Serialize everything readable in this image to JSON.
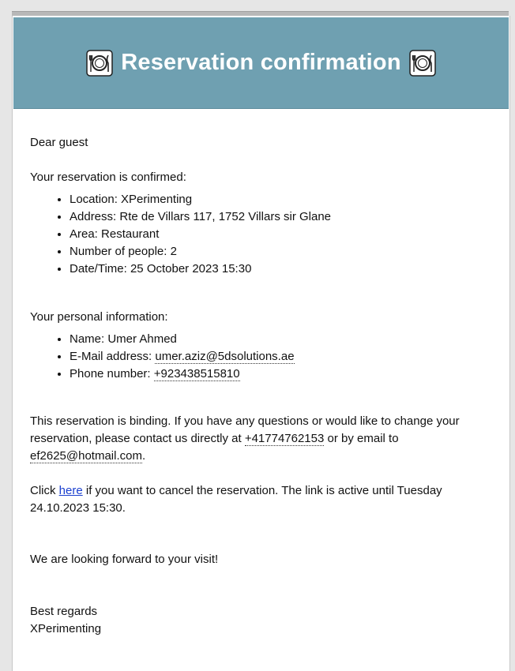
{
  "header": {
    "title": "Reservation confirmation",
    "icon": "plate-fork-knife-icon",
    "bg_color": "#6fa0b1"
  },
  "greeting": "Dear guest",
  "reservation": {
    "intro": "Your reservation is confirmed:",
    "items": [
      "Location: XPerimenting",
      "Address: Rte de Villars 117, 1752 Villars sir Glane",
      "Area: Restaurant",
      "Number of people: 2",
      "Date/Time: 25 October 2023 15:30"
    ]
  },
  "personal": {
    "intro": "Your personal information:",
    "name_item": "Name: Umer Ahmed",
    "email_label": "E-Mail address: ",
    "email": "umer.aziz@5dsolutions.ae",
    "phone_label": "Phone number: ",
    "phone": "+923438515810"
  },
  "binding": {
    "text_1": "This reservation is binding. If you have any questions or would like to change your reservation, please contact us directly at ",
    "phone": "+41774762153",
    "text_2": " or by email to ",
    "email": "ef2625@hotmail.com",
    "text_3": "."
  },
  "cancel": {
    "text_1": "Click ",
    "link": "here",
    "text_2": " if you want to cancel the reservation. The link is active until Tuesday 24.10.2023 15:30."
  },
  "closing": "We are looking forward to your visit!",
  "signoff": {
    "regards": "Best regards",
    "sender": "XPerimenting"
  }
}
